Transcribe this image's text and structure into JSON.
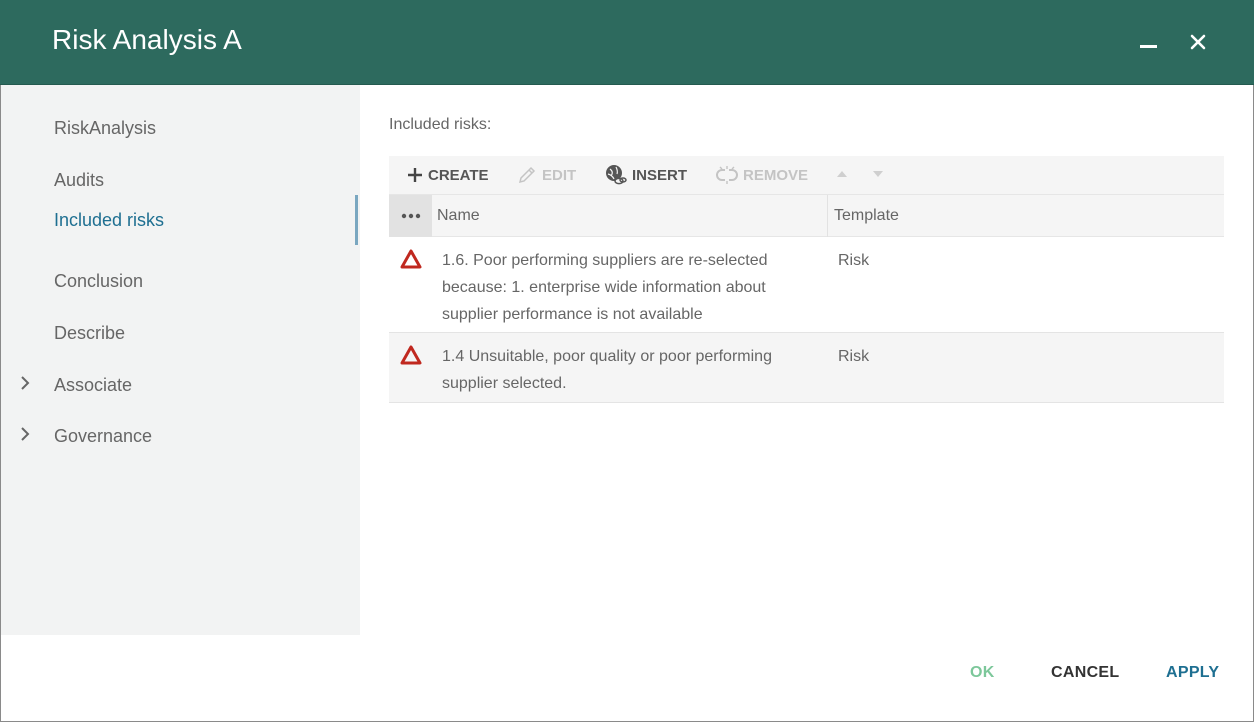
{
  "window": {
    "title": "Risk Analysis A"
  },
  "sidebar": {
    "items": [
      {
        "label": "RiskAnalysis"
      },
      {
        "label": "Audits"
      },
      {
        "label": "Included risks"
      },
      {
        "label": "Conclusion"
      },
      {
        "label": "Describe"
      },
      {
        "label": "Associate"
      },
      {
        "label": "Governance"
      }
    ],
    "active": "Included risks"
  },
  "main": {
    "section_label": "Included risks:",
    "toolbar": {
      "create": "CREATE",
      "edit": "EDIT",
      "insert": "INSERT",
      "remove": "REMOVE"
    },
    "grid": {
      "columns": [
        "Name",
        "Template"
      ],
      "rows": [
        {
          "name": "1.6. Poor performing suppliers are re-selected because: 1. enterprise wide information about supplier performance is not available",
          "template": "Risk"
        },
        {
          "name": "1.4 Unsuitable, poor quality or poor performing supplier selected.",
          "template": "Risk"
        }
      ]
    }
  },
  "footer": {
    "ok": "OK",
    "cancel": "CANCEL",
    "apply": "APPLY"
  },
  "colors": {
    "titlebar": "#2d6a5e",
    "accent": "#1e6f91",
    "ok": "#7cc79a",
    "risk_icon": "#c0281f"
  }
}
